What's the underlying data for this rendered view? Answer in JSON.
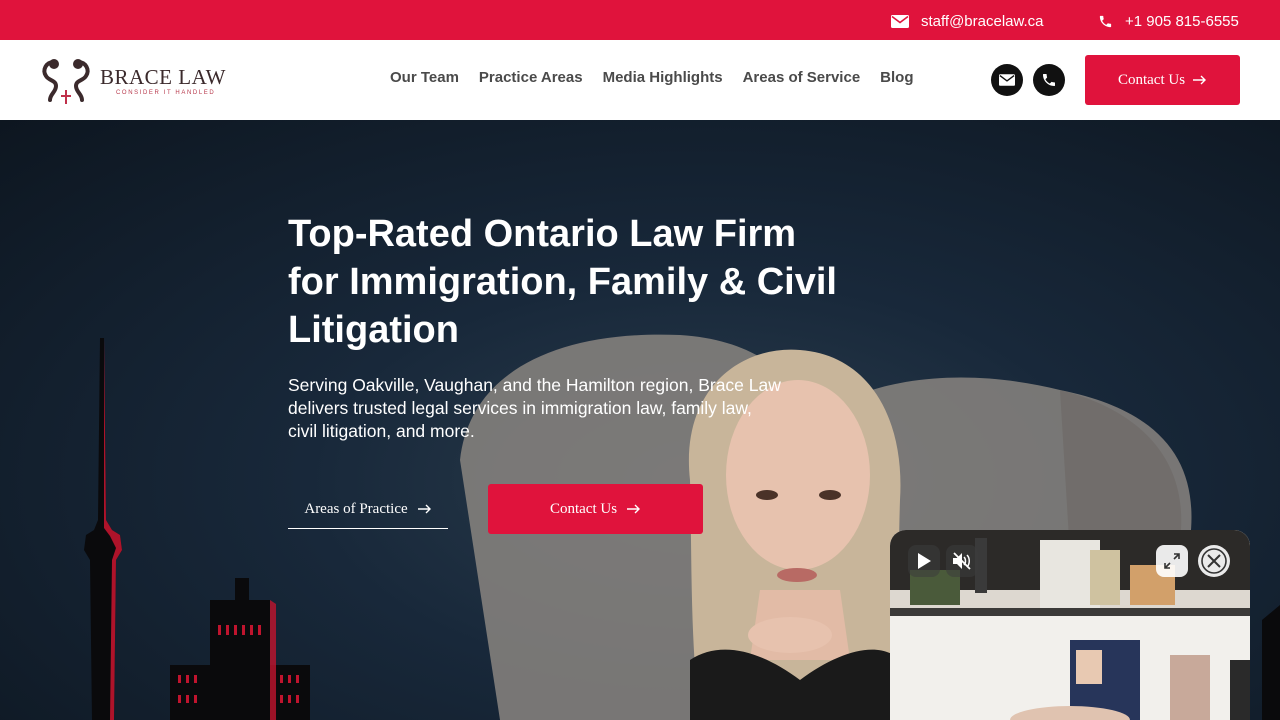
{
  "topbar": {
    "email": "staff@bracelaw.ca",
    "phone": "+1 905 815-6555",
    "icons": [
      "envelope-icon",
      "phone-icon"
    ]
  },
  "header": {
    "logo": {
      "name": "BRACE LAW",
      "tagline": "CONSIDER IT HANDLED"
    },
    "nav": [
      "Our Team",
      "Practice Areas",
      "Media Highlights",
      "Areas of Service",
      "Blog"
    ],
    "contact_label": "Contact Us",
    "icon_buttons": [
      "envelope-icon",
      "phone-icon"
    ]
  },
  "hero": {
    "title": "Top-Rated Ontario Law Firm for Immigration, Family & Civil Litigation",
    "subtitle": "Serving Oakville, Vaughan, and the Hamilton region, Brace Law delivers trusted legal services in immigration law, family law, civil litigation, and more.",
    "secondary_cta": "Areas of Practice",
    "primary_cta": "Contact Us"
  },
  "video_popup": {
    "controls": [
      "play-icon",
      "mute-icon",
      "expand-icon",
      "close-icon"
    ]
  },
  "colors": {
    "brand_red": "#e0133c",
    "dark_text": "#4a4a4a",
    "hero_bg": "#18283a"
  }
}
